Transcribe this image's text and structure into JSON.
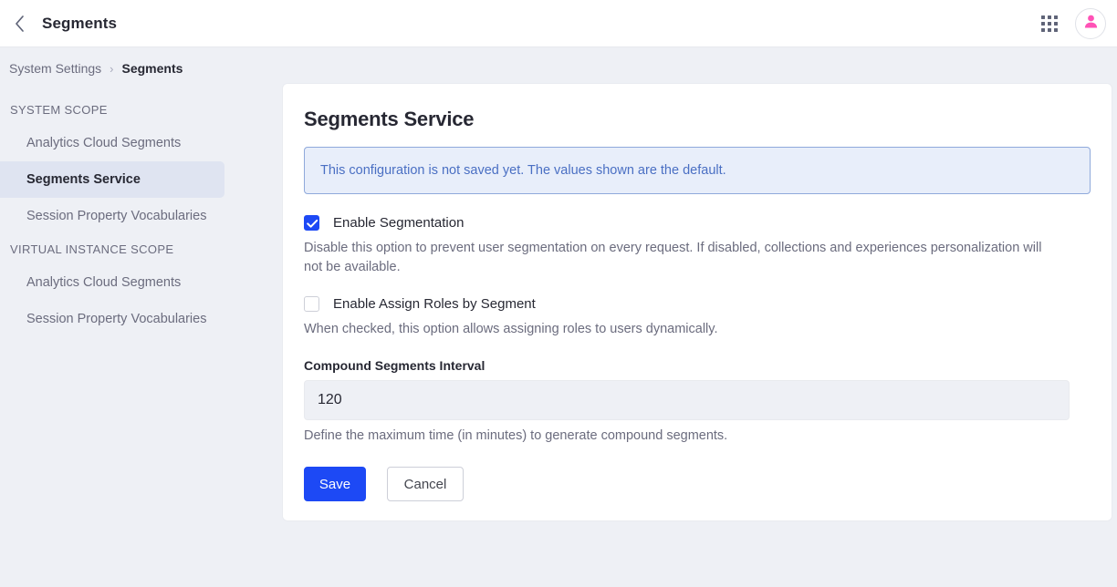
{
  "topbar": {
    "back_icon": "chevron-left-icon",
    "title": "Segments",
    "apps_icon": "app-grid-icon",
    "avatar_icon": "user-avatar-icon"
  },
  "breadcrumb": {
    "parent": "System Settings",
    "separator": "›",
    "current": "Segments"
  },
  "sidebar": {
    "groups": [
      {
        "title": "SYSTEM SCOPE",
        "items": [
          {
            "label": "Analytics Cloud Segments",
            "active": false
          },
          {
            "label": "Segments Service",
            "active": true
          },
          {
            "label": "Session Property Vocabularies",
            "active": false
          }
        ]
      },
      {
        "title": "VIRTUAL INSTANCE SCOPE",
        "items": [
          {
            "label": "Analytics Cloud Segments",
            "active": false
          },
          {
            "label": "Session Property Vocabularies",
            "active": false
          }
        ]
      }
    ]
  },
  "main": {
    "title": "Segments Service",
    "alert": {
      "message": "This configuration is not saved yet. The values shown are the default.",
      "background": "#e8eefa",
      "border": "#8fa9db",
      "text_color": "#4a6fc3"
    },
    "options": [
      {
        "label": "Enable Segmentation",
        "checked": true,
        "help": "Disable this option to prevent user segmentation on every request. If disabled, collections and experiences personalization will not be available."
      },
      {
        "label": "Enable Assign Roles by Segment",
        "checked": false,
        "help": "When checked, this option allows assigning roles to users dynamically."
      }
    ],
    "interval_field": {
      "label": "Compound Segments Interval",
      "value": "120",
      "placeholder": "",
      "help": "Define the maximum time (in minutes) to generate compound segments."
    },
    "buttons": {
      "save": "Save",
      "cancel": "Cancel"
    }
  },
  "colors": {
    "accent": "#1d49f5",
    "page_background": "#eef0f5",
    "avatar_pink": "#ff52b6",
    "text_primary": "#272833",
    "text_secondary": "#6b6c7e"
  }
}
